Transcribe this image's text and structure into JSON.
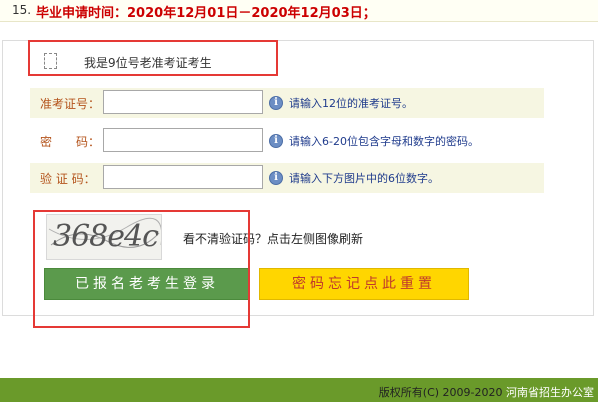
{
  "notice": {
    "number": "15.",
    "label": "毕业申请时间：",
    "dates": "2020年12月01日－2020年12月03日；"
  },
  "checkbox": {
    "label": "我是9位号老准考证考生",
    "checked": false
  },
  "form": {
    "fields": [
      {
        "label": "准考证号：",
        "value": "",
        "hint": "请输入12位的准考证号。"
      },
      {
        "label": "密　　码：",
        "value": "",
        "hint": "请输入6-20位包含字母和数字的密码。"
      },
      {
        "label": "验 证 码：",
        "value": "",
        "hint": "请输入下方图片中的6位数字。"
      }
    ]
  },
  "captcha": {
    "image_text": "368e4c",
    "refresh_hint": "看不清验证码？点击左侧图像刷新"
  },
  "buttons": {
    "login_label": "已报名老考生登录",
    "reset_label": "密码忘记点此重置"
  },
  "footer": {
    "copyright": "版权所有(C) 2009-2020",
    "org": "河南省招生办公室"
  },
  "colors": {
    "login_button": "#5b9a4c",
    "reset_button": "#ffd600",
    "footer": "#6a9a2a",
    "annotation_box": "#e53935"
  }
}
